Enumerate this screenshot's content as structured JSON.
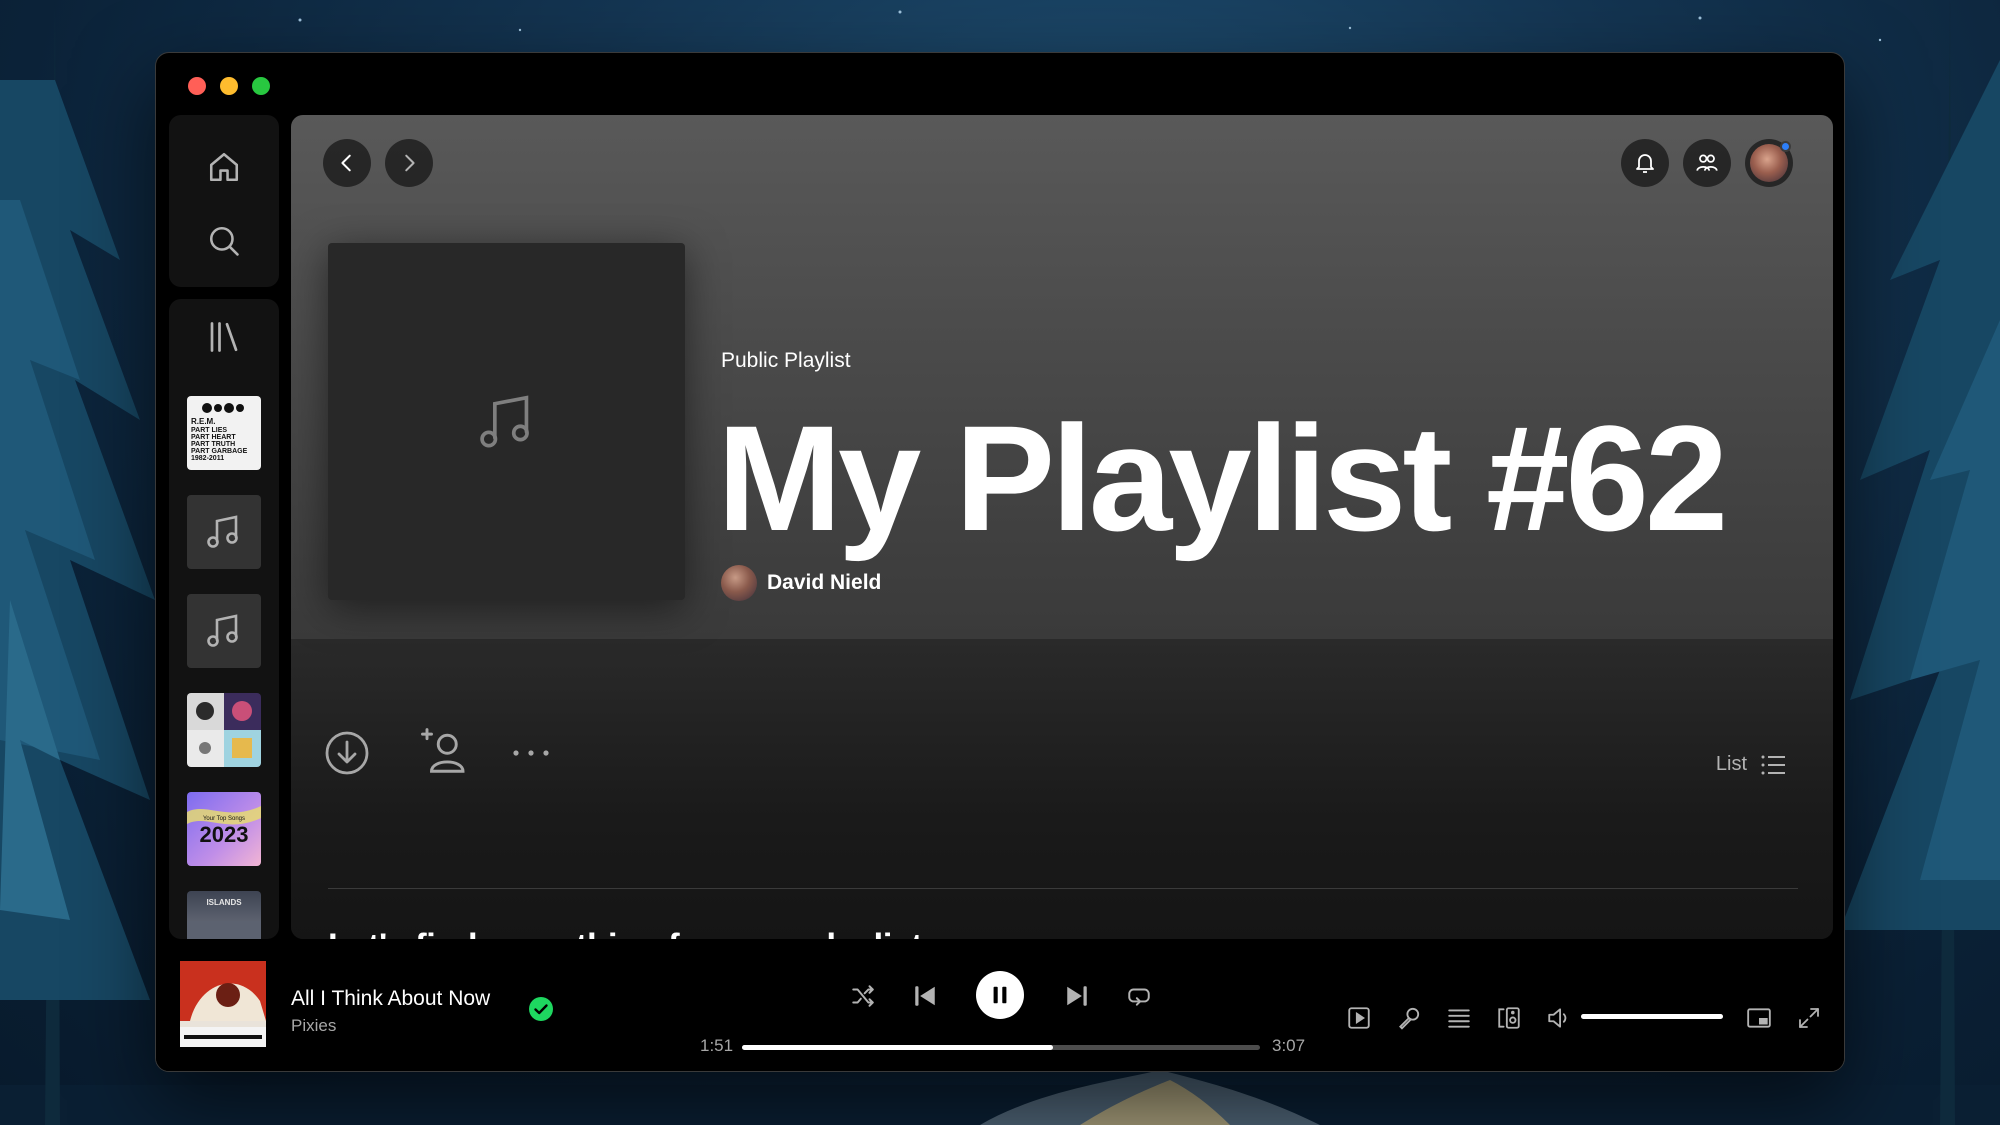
{
  "app": {
    "accent_color": "#1ed760",
    "window_buttons": [
      "close",
      "minimize",
      "zoom"
    ]
  },
  "sidebar": {
    "nav": [
      {
        "icon": "home-icon"
      },
      {
        "icon": "search-icon"
      }
    ],
    "library_icon": "library-icon",
    "library_items": [
      {
        "kind": "album-art",
        "lines": [
          "R.E.M.",
          "PART LIES",
          "PART HEART",
          "PART TRUTH",
          "PART GARBAGE",
          "1982-2011"
        ]
      },
      {
        "kind": "music-note-placeholder"
      },
      {
        "kind": "music-note-placeholder"
      },
      {
        "kind": "collage-art"
      },
      {
        "kind": "album-art",
        "lines": [
          "Your Top Songs",
          "2023"
        ]
      },
      {
        "kind": "album-art",
        "lines": [
          "ISLANDS"
        ]
      }
    ]
  },
  "header": {
    "back_icon": "chevron-left-icon",
    "forward_icon": "chevron-right-icon",
    "notifications_icon": "bell-icon",
    "friends_icon": "friend-activity-icon"
  },
  "playlist": {
    "type_label": "Public Playlist",
    "title": "My Playlist #62",
    "owner": "David Nield"
  },
  "actions": {
    "download_icon": "download-icon",
    "invite_icon": "add-collaborator-icon",
    "more_icon": "more-options-icon",
    "view_label": "List"
  },
  "recommendations": {
    "title": "Let's find something for your playlist"
  },
  "now_playing": {
    "track": "All I Think About Now",
    "artist": "Pixies",
    "liked": true,
    "elapsed": "1:51",
    "duration": "3:07",
    "progress": 0.6,
    "is_playing": true,
    "volume": 1.0
  },
  "player_controls": {
    "shuffle_icon": "shuffle-icon",
    "previous_icon": "skip-previous-icon",
    "pause_icon": "pause-icon",
    "next_icon": "skip-next-icon",
    "repeat_icon": "repeat-icon",
    "now_playing_view_icon": "now-playing-view-icon",
    "lyrics_icon": "microphone-icon",
    "queue_icon": "queue-icon",
    "devices_icon": "connect-device-icon",
    "volume_icon": "volume-icon",
    "miniplayer_icon": "miniplayer-icon",
    "fullscreen_icon": "fullscreen-icon"
  }
}
